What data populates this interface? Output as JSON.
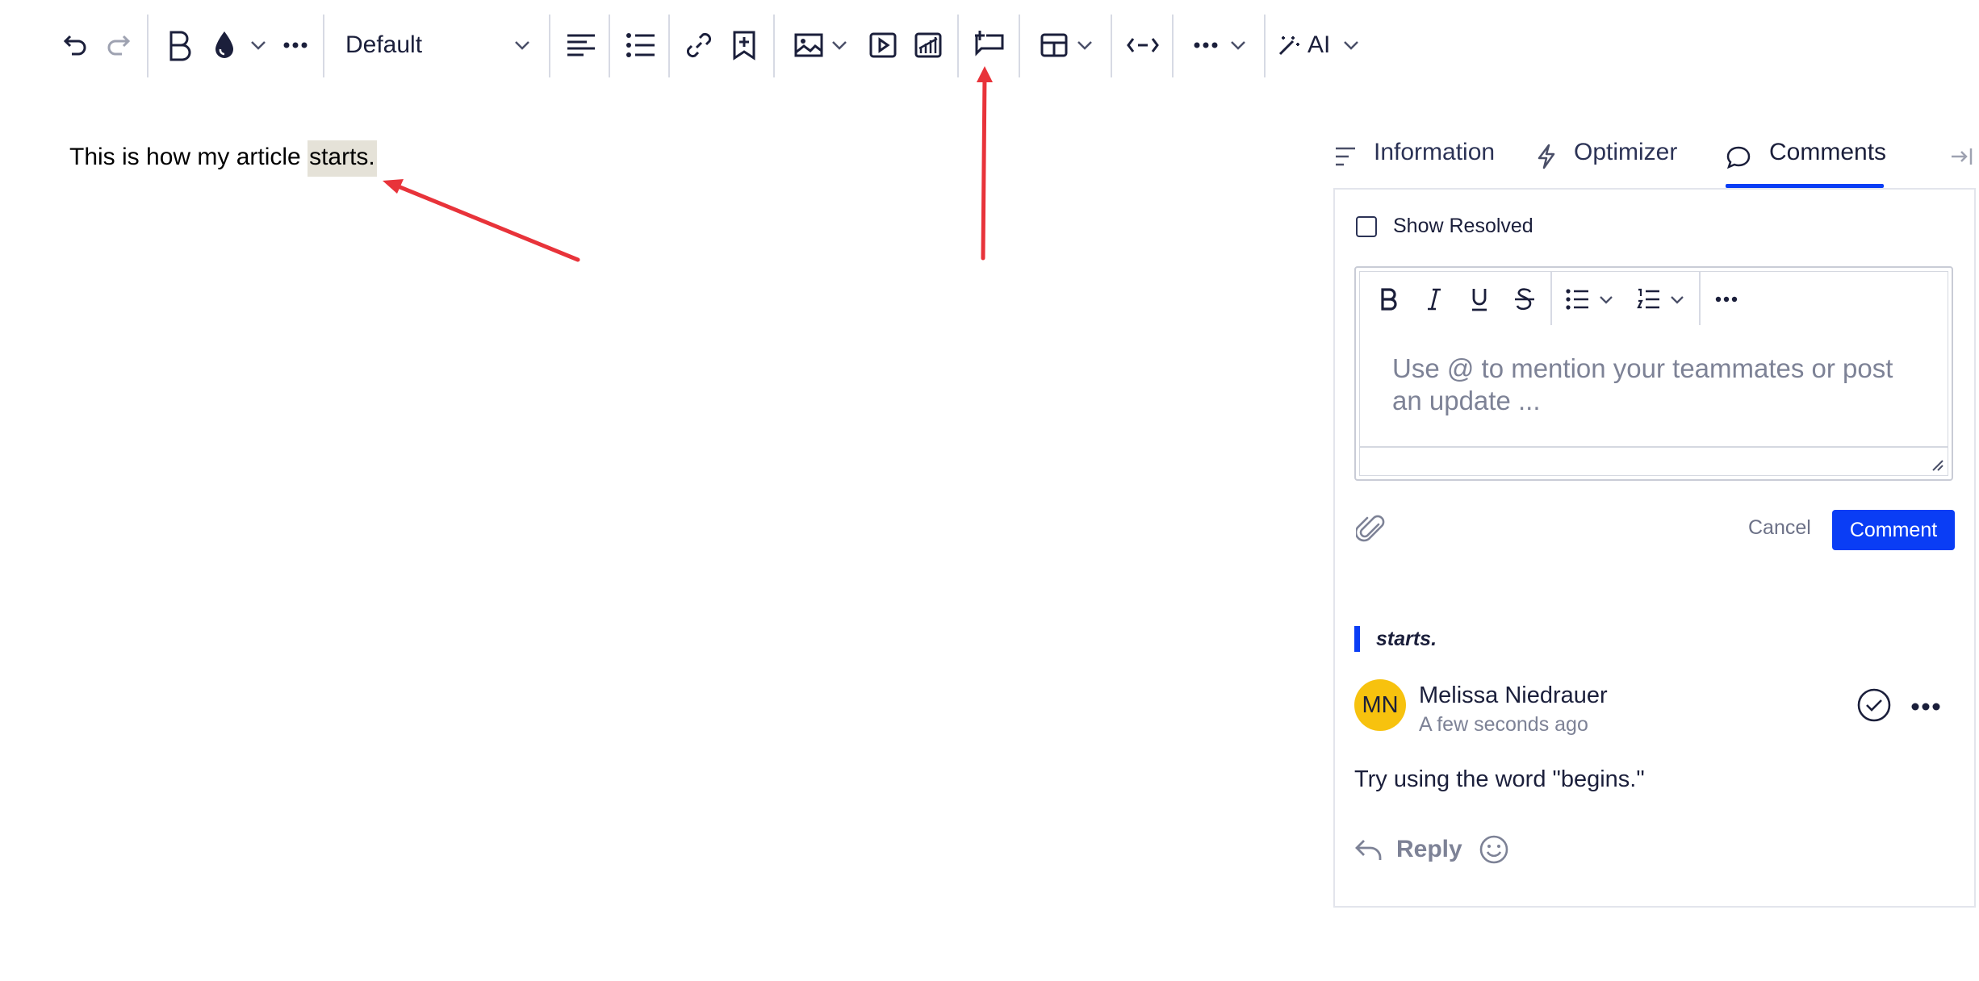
{
  "toolbar": {
    "style_dropdown": "Default",
    "ai_label": "AI",
    "icons": [
      "undo-icon",
      "redo-icon",
      "bold-icon",
      "text-color-icon",
      "chevron-down-icon",
      "more-icon",
      "align-left-icon",
      "bullet-list-icon",
      "link-icon",
      "bookmark-add-icon",
      "image-icon",
      "video-icon",
      "chart-icon",
      "add-comment-icon",
      "table-icon",
      "expand-width-icon",
      "more-icon",
      "ai-wand-icon"
    ]
  },
  "editor": {
    "text_before": "This is how my article ",
    "highlighted": "starts."
  },
  "sidebar": {
    "tabs": [
      {
        "label": "Information",
        "icon": "list-icon"
      },
      {
        "label": "Optimizer",
        "icon": "lightning-icon"
      },
      {
        "label": "Comments",
        "icon": "chat-bubble-icon",
        "active": true
      }
    ],
    "show_resolved_label": "Show Resolved",
    "composer": {
      "placeholder": "Use @ to mention your teammates or post an update ...",
      "cancel_label": "Cancel",
      "comment_label": "Comment"
    },
    "thread": {
      "quote": "starts.",
      "avatar_initials": "MN",
      "author": "Melissa Niedrauer",
      "time": "A few seconds ago",
      "body": "Try using the word \"begins.\"",
      "reply_label": "Reply"
    }
  },
  "colors": {
    "accent": "#0a3df5",
    "avatar": "#f7c20e",
    "highlight": "#e5e2d8",
    "annotation_arrow": "#e8333a"
  }
}
